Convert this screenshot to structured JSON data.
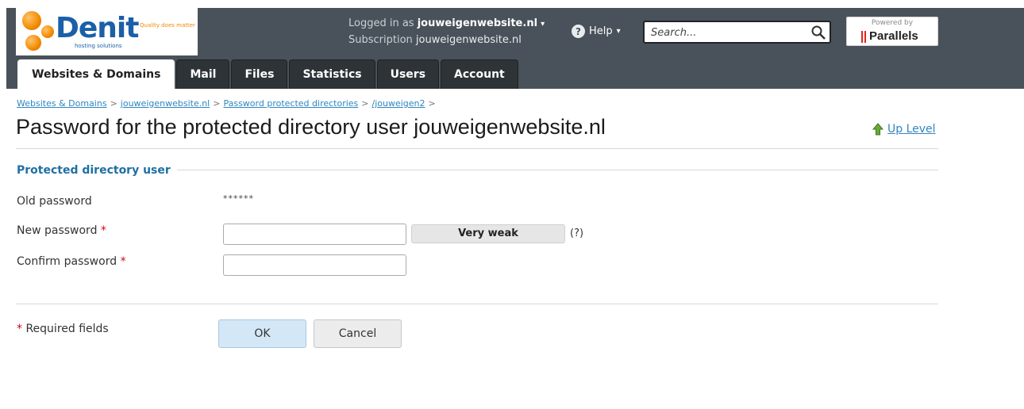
{
  "header": {
    "logo": {
      "name": "Denit",
      "subtitle": "hosting solutions",
      "tagline": "Quality does matter"
    },
    "login": {
      "logged_in_label": "Logged in as",
      "logged_in_value": "jouweigenwebsite.nl",
      "subscription_label": "Subscription",
      "subscription_value": "jouweigenwebsite.nl"
    },
    "help_label": "Help",
    "search_placeholder": "Search...",
    "powered_by": "Powered by",
    "powered_brand": "Parallels"
  },
  "tabs": [
    {
      "label": "Websites & Domains",
      "active": true
    },
    {
      "label": "Mail",
      "active": false
    },
    {
      "label": "Files",
      "active": false
    },
    {
      "label": "Statistics",
      "active": false
    },
    {
      "label": "Users",
      "active": false
    },
    {
      "label": "Account",
      "active": false
    }
  ],
  "breadcrumb": [
    "Websites & Domains",
    "jouweigenwebsite.nl",
    "Password protected directories",
    "/jouweigen2"
  ],
  "page_title": "Password for the protected directory user jouweigenwebsite.nl",
  "up_level_label": "Up Level",
  "section_title": "Protected directory user",
  "form": {
    "old_password_label": "Old password",
    "old_password_value": "******",
    "new_password_label": "New password",
    "confirm_password_label": "Confirm password",
    "required_marker": "*",
    "strength_label": "Very weak",
    "strength_help": "(?)"
  },
  "footer": {
    "required_note": "Required fields",
    "ok_label": "OK",
    "cancel_label": "Cancel"
  },
  "colors": {
    "header_bg": "#49525a",
    "tab_bg": "#2e3337",
    "link": "#2f86c0",
    "section_title": "#1f6fa4",
    "required": "#d0021b",
    "ok_button": "#d4e7f7"
  }
}
